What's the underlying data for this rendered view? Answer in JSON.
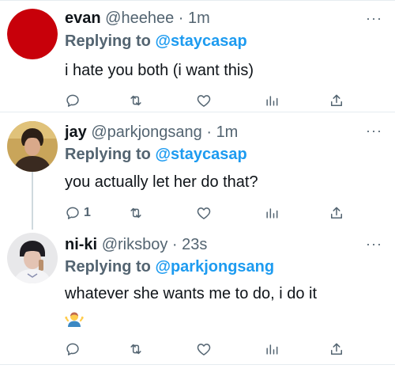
{
  "replying_prefix": "Replying to",
  "tweets": [
    {
      "display_name": "evan",
      "handle": "@heehee",
      "time": "1m",
      "reply_to": "@staycasap",
      "text": "i hate you both (i want this)",
      "reply_count": ""
    },
    {
      "display_name": "jay",
      "handle": "@parkjongsang",
      "time": "1m",
      "reply_to": "@staycasap",
      "text": "you actually let her do that?",
      "reply_count": "1"
    },
    {
      "display_name": "ni-ki",
      "handle": "@riksboy",
      "time": "23s",
      "reply_to": "@parkjongsang",
      "text": "whatever she wants me to do, i do it",
      "reply_count": "",
      "emoji": "person-shrugging-emoji"
    }
  ],
  "separator": "·",
  "more_glyph": "···",
  "colors": {
    "link": "#1d9bf0",
    "muted": "#536471",
    "text": "#0f1419",
    "divider": "#e6ecf0",
    "thread_line": "#cfd9de",
    "avatar_red": "#c8000a"
  },
  "icons": [
    "reply-icon",
    "retweet-icon",
    "like-icon",
    "views-icon",
    "share-icon",
    "more-icon"
  ]
}
